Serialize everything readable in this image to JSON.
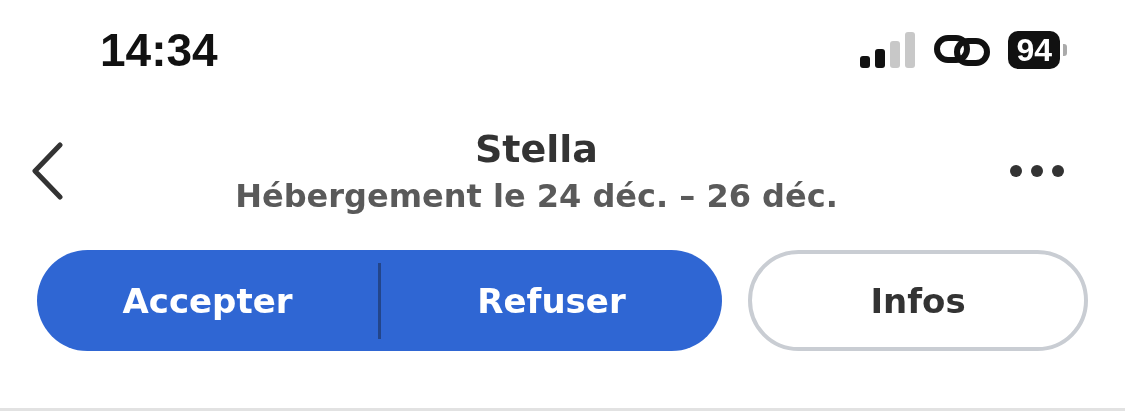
{
  "status_bar": {
    "time": "14:34",
    "battery": "94"
  },
  "header": {
    "title": "Stella",
    "subtitle": "Hébergement le 24 déc. – 26 déc."
  },
  "actions": {
    "segmented": [
      "Accepter",
      "Refuser"
    ],
    "secondary": "Infos"
  }
}
